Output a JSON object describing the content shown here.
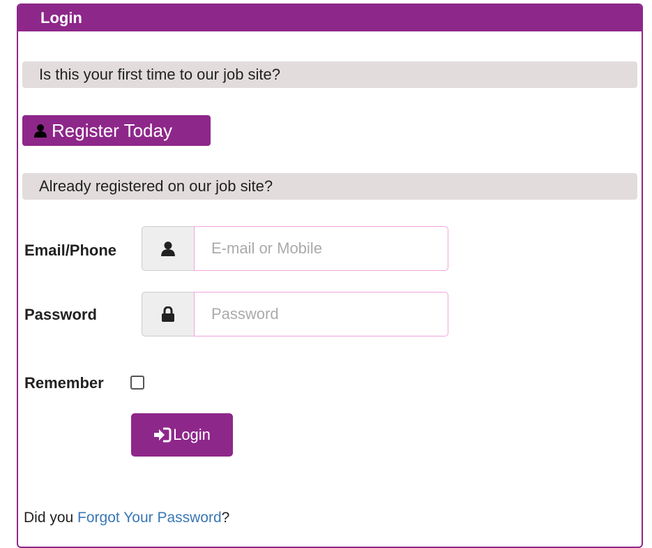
{
  "panel": {
    "title": "Login"
  },
  "register_section": {
    "prompt": "Is this your first time to our job site?",
    "button_label": "Register Today",
    "button_icon": "user-icon"
  },
  "login_section": {
    "prompt": "Already registered on our job site?",
    "email": {
      "label": "Email/Phone",
      "placeholder": "E-mail or Mobile",
      "value": "",
      "icon": "user-icon"
    },
    "password": {
      "label": "Password",
      "placeholder": "Password",
      "value": "",
      "icon": "lock-icon"
    },
    "remember": {
      "label": "Remember",
      "checked": false
    },
    "submit_label": "Login",
    "submit_icon": "sign-in-icon"
  },
  "footer": {
    "prefix": "Did you ",
    "link_text": "Forgot Your Password",
    "suffix": "?"
  },
  "colors": {
    "brand": "#8e278a",
    "section_bg": "#e2dcdc",
    "link": "#3a78b5",
    "input_border": "#f2a3df"
  }
}
